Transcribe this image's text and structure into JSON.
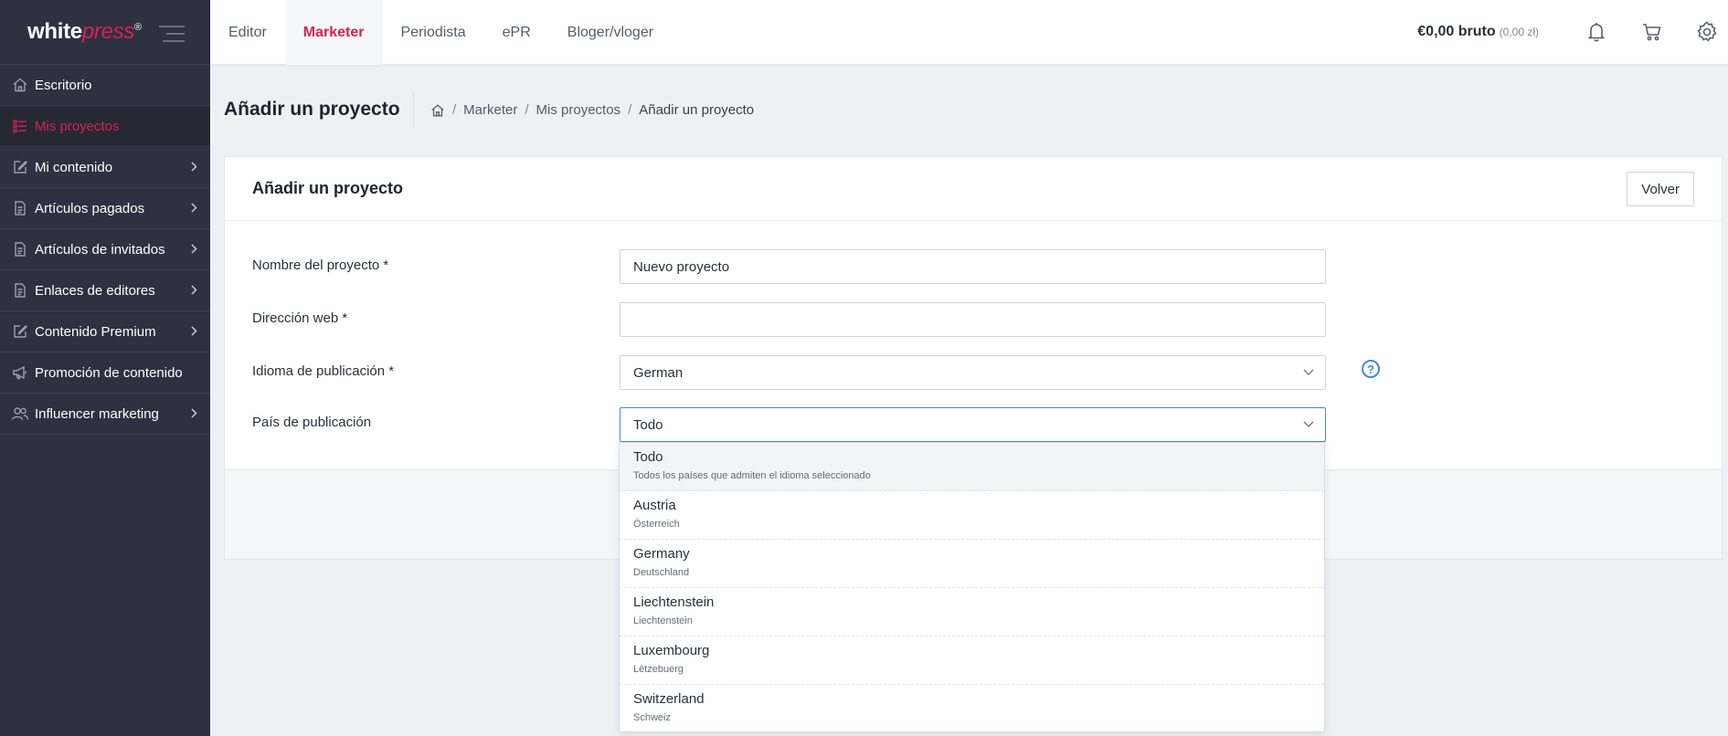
{
  "brand": {
    "logo_bold": "white",
    "logo_italic": "press",
    "logo_mark": "®",
    "accent": "#d6234d"
  },
  "sidebar": {
    "items": [
      {
        "label": "Escritorio",
        "icon": "home-icon",
        "has_children": false,
        "active": false
      },
      {
        "label": "Mis proyectos",
        "icon": "list-icon",
        "has_children": false,
        "active": true
      },
      {
        "label": "Mi contenido",
        "icon": "edit-icon",
        "has_children": true,
        "active": false
      },
      {
        "label": "Artículos pagados",
        "icon": "document-icon",
        "has_children": true,
        "active": false
      },
      {
        "label": "Artículos de invitados",
        "icon": "document-icon",
        "has_children": true,
        "active": false
      },
      {
        "label": "Enlaces de editores",
        "icon": "document-icon",
        "has_children": true,
        "active": false
      },
      {
        "label": "Contenido Premium",
        "icon": "edit-icon",
        "has_children": true,
        "active": false
      },
      {
        "label": "Promoción de contenido",
        "icon": "megaphone-icon",
        "has_children": false,
        "active": false
      },
      {
        "label": "Influencer marketing",
        "icon": "users-icon",
        "has_children": true,
        "active": false
      }
    ]
  },
  "topbar": {
    "tabs": [
      {
        "label": "Editor",
        "active": false
      },
      {
        "label": "Marketer",
        "active": true
      },
      {
        "label": "Periodista",
        "active": false
      },
      {
        "label": "ePR",
        "active": false
      },
      {
        "label": "Bloger/vloger",
        "active": false
      }
    ],
    "balance": "€0,00 bruto",
    "balance_sub": "(0,00 zł)"
  },
  "page": {
    "title": "Añadir un proyecto",
    "breadcrumb": [
      "Marketer",
      "Mis proyectos",
      "Añadir un proyecto"
    ]
  },
  "form": {
    "card_title": "Añadir un proyecto",
    "back_label": "Volver",
    "name_label": "Nombre del proyecto *",
    "name_value": "Nuevo proyecto",
    "web_label": "Dirección web *",
    "web_value": "",
    "lang_label": "Idioma de publicación *",
    "lang_value": "German",
    "country_label": "País de publicación",
    "country_value": "Todo",
    "help": "?"
  },
  "country_options": [
    {
      "name": "Todo",
      "local": "Todos los países que admiten el idioma seleccionado"
    },
    {
      "name": "Austria",
      "local": "Österreich"
    },
    {
      "name": "Germany",
      "local": "Deutschland"
    },
    {
      "name": "Liechtenstein",
      "local": "Liechtenstein"
    },
    {
      "name": "Luxembourg",
      "local": "Lëtzebuerg"
    },
    {
      "name": "Switzerland",
      "local": "Schweiz"
    }
  ]
}
